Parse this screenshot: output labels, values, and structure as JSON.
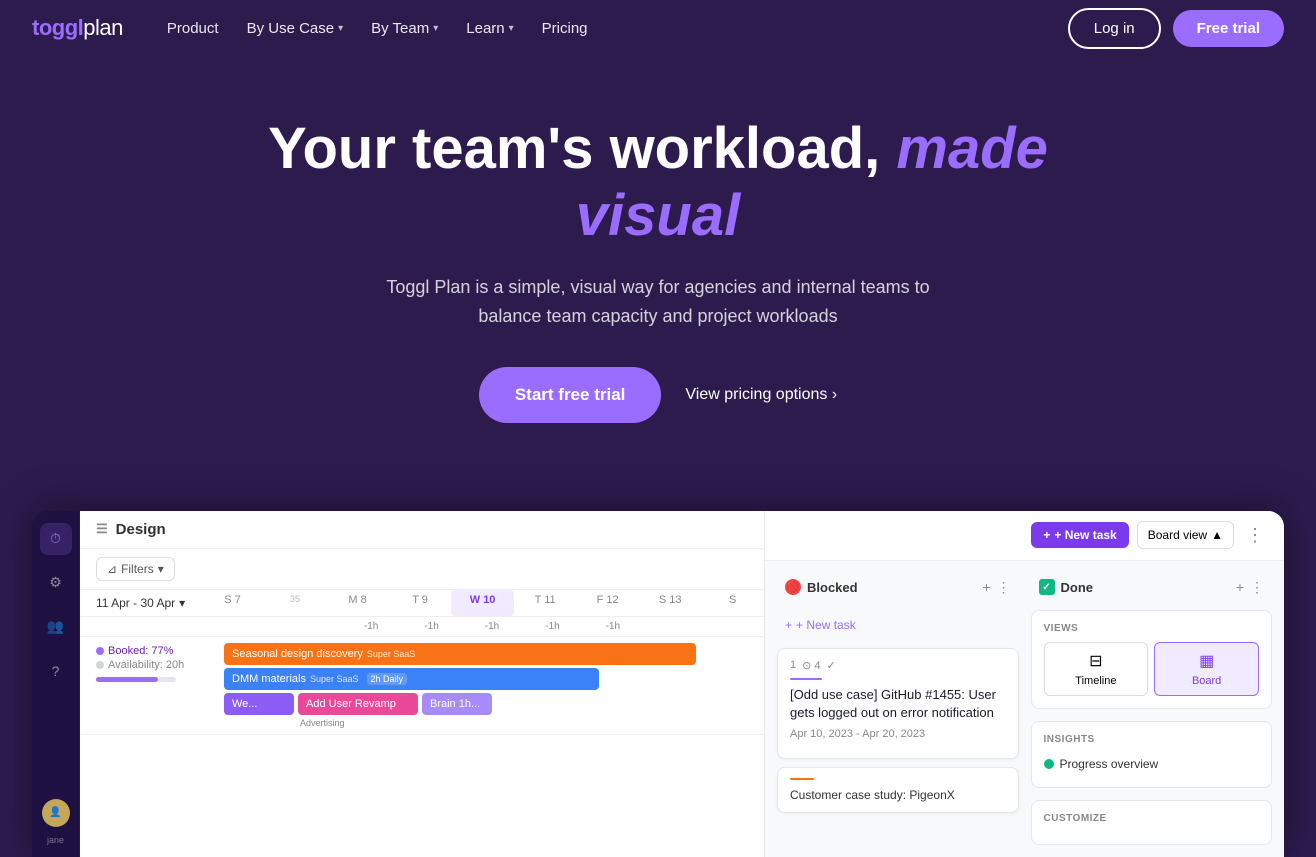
{
  "brand": {
    "toggl": "toggl",
    "plan": "plan"
  },
  "nav": {
    "product": "Product",
    "by_use_case": "By Use Case",
    "by_team": "By Team",
    "learn": "Learn",
    "pricing": "Pricing",
    "login": "Log in",
    "free_trial": "Free trial"
  },
  "hero": {
    "title_main": "Your team's workload,",
    "title_accent": "made visual",
    "subtitle": "Toggl Plan is a simple, visual way for agencies and internal teams to balance team capacity and project workloads",
    "cta_start": "Start free trial",
    "cta_pricing": "View pricing options ›"
  },
  "app_preview": {
    "left_panel": {
      "title": "Design",
      "filter_label": "Filters",
      "date_range": "11 Apr - 30 Apr",
      "columns": [
        "S 7",
        "35",
        "M 8",
        "T 9",
        "W 10",
        "T 11",
        "F 12",
        "S 13",
        "S"
      ],
      "minus_labels": [
        "-1h",
        "-1h",
        "-1h",
        "-1h",
        "-1h"
      ],
      "person": {
        "name": "Jane",
        "booking": "Booked: 77%",
        "availability": "Availability: 20h",
        "progress": 77
      },
      "tasks": [
        {
          "label": "Seasonal design discovery",
          "sub": "Super SaaS",
          "color": "orange",
          "width": "85%"
        },
        {
          "label": "DMM materials",
          "sub": "Super SaaS",
          "badge": "2h Daily",
          "color": "blue",
          "width": "65%"
        },
        {
          "label": "We...",
          "color": "purple",
          "width": "18%"
        },
        {
          "label": "Add User Revamp",
          "sub": "Advertising",
          "color": "pink",
          "width": "32%"
        },
        {
          "label": "Brain 1h...",
          "color": "salmon",
          "width": "20%"
        }
      ]
    },
    "right_panel": {
      "new_task_btn": "+ New task",
      "board_view_btn": "Board view",
      "columns": {
        "blocked": {
          "title": "Blocked",
          "icon": "🚫"
        },
        "done": {
          "title": "Done",
          "icon": "✓"
        }
      },
      "new_task_inline": "+ New task",
      "task_card": {
        "meta": "1  ⊙ 4  ✓",
        "title": "[Odd use case] GitHub #1455: User gets logged out on error notification",
        "date": "Apr 10, 2023 - Apr 20, 2023"
      },
      "customer_case": {
        "accent_color": "#f97316",
        "title": "Customer case study: PigeonX"
      },
      "views": {
        "label": "VIEWS",
        "timeline_label": "Timeline",
        "board_label": "Board"
      },
      "insights": {
        "label": "INSIGHTS",
        "progress_overview": "Progress overview"
      },
      "customize": {
        "label": "CUSTOMIZE"
      }
    }
  },
  "colors": {
    "brand_purple": "#9b6dff",
    "dark_bg": "#2d1b4e",
    "sidebar_bg": "#1e1040",
    "accent": "#7c3aed"
  }
}
